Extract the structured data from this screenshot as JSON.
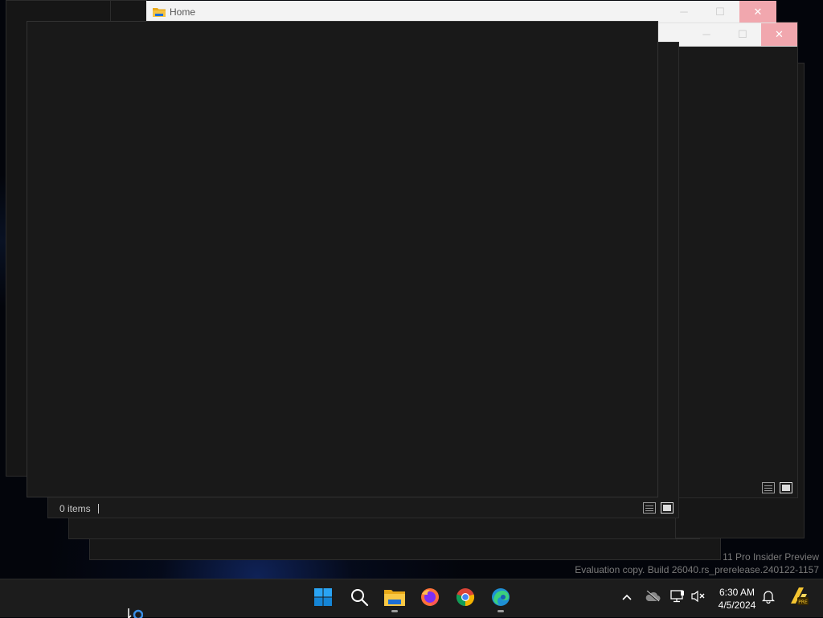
{
  "windows": {
    "home": {
      "title": "Home",
      "minimize_glyph": "─",
      "maximize_glyph": "☐",
      "close_glyph": "✕"
    },
    "second": {
      "minimize_glyph": "─",
      "maximize_glyph": "☐",
      "close_glyph": "✕"
    },
    "front": {
      "status_items": "0 items"
    }
  },
  "watermark": {
    "line1": "11 Pro Insider Preview",
    "line2": "Evaluation copy. Build 26040.rs_prerelease.240122-1157"
  },
  "taskbar": {
    "apps": [
      {
        "name": "Start",
        "icon": "windows-logo-icon"
      },
      {
        "name": "Search",
        "icon": "search-icon"
      },
      {
        "name": "File Explorer",
        "icon": "folder-icon"
      },
      {
        "name": "Firefox",
        "icon": "firefox-icon"
      },
      {
        "name": "Chrome",
        "icon": "chrome-icon"
      },
      {
        "name": "Edge",
        "icon": "edge-icon"
      }
    ],
    "clock": {
      "time": "6:30 AM",
      "date": "4/5/2024"
    }
  },
  "colors": {
    "window_bg": "#191919",
    "titlebar_bg": "#f3f3f3",
    "close_bg": "#f1a7ae",
    "taskbar_bg": "#1c1c1c",
    "accent": "#0078d4"
  }
}
